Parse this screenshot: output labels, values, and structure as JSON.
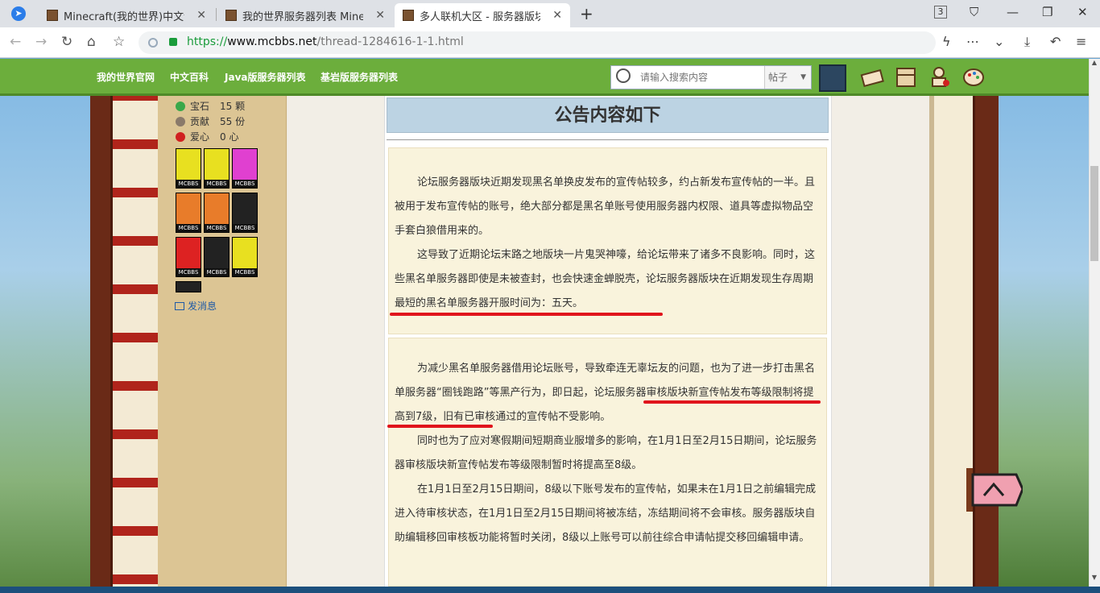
{
  "browser": {
    "tabs": [
      {
        "title": "Minecraft(我的世界)中文论坛",
        "active": false
      },
      {
        "title": "我的世界服务器列表 Minecra",
        "active": false
      },
      {
        "title": "多人联机大区 - 服务器版块 提",
        "active": true
      }
    ],
    "tab_count_badge": "3",
    "url_proto": "https://",
    "url_host": "www.mcbbs.net",
    "url_path": "/thread-1284616-1-1.html"
  },
  "nav": {
    "links": [
      "我的世界官网",
      "中文百科",
      "Java版服务器列表",
      "基岩版服务器列表"
    ],
    "search_placeholder": "请输入搜索内容",
    "search_scope": "帖子"
  },
  "user": {
    "stats": [
      {
        "label": "宝石",
        "value": "15 颗",
        "color": "#3aa84a"
      },
      {
        "label": "贡献",
        "value": "55 份",
        "color": "#8a7a6a"
      },
      {
        "label": "爱心",
        "value": "0 心",
        "color": "#d02020"
      }
    ],
    "medal_tag": "MCBBS",
    "send_message": "发消息"
  },
  "post": {
    "title": "公告内容如下",
    "p1": "论坛服务器版块近期发现黑名单换皮发布的宣传帖较多，约占新发布宣传帖的一半。且被用于发布宣传帖的账号，绝大部分都是黑名单账号使用服务器内权限、道具等虚拟物品空手套白狼借用来的。",
    "p2": "这导致了近期论坛末路之地版块一片鬼哭神嚎，给论坛带来了诸多不良影响。同时，这些黑名单服务器即使是未被查封，也会快速金蝉脱壳，论坛服务器版块在近期发现生存周期最短的黑名单服务器开服时间为：五天。",
    "p3": "为减少黑名单服务器借用论坛账号，导致牵连无辜坛友的问题，也为了进一步打击黑名单服务器“圈钱跑路”等黑产行为，即日起，论坛服务器审核版块新宣传帖发布等级限制将提高到7级，旧有已审核通过的宣传帖不受影响。",
    "p4": "同时也为了应对寒假期间短期商业服增多的影响，在1月1日至2月15日期间，论坛服务器审核版块新宣传帖发布等级限制暂时将提高至8级。",
    "p5": "在1月1日至2月15日期间，8级以下账号发布的宣传帖，如果未在1月1日之前编辑完成进入待审核状态，在1月1日至2月15日期间将被冻结，冻结期间将不会审核。服务器版块自助编辑移回审核板功能将暂时关闭，8级以上账号可以前往综合申请帖提交移回编辑申请。"
  },
  "colors": {
    "underline": "#e0141c",
    "nav_green": "#6cae3c"
  }
}
